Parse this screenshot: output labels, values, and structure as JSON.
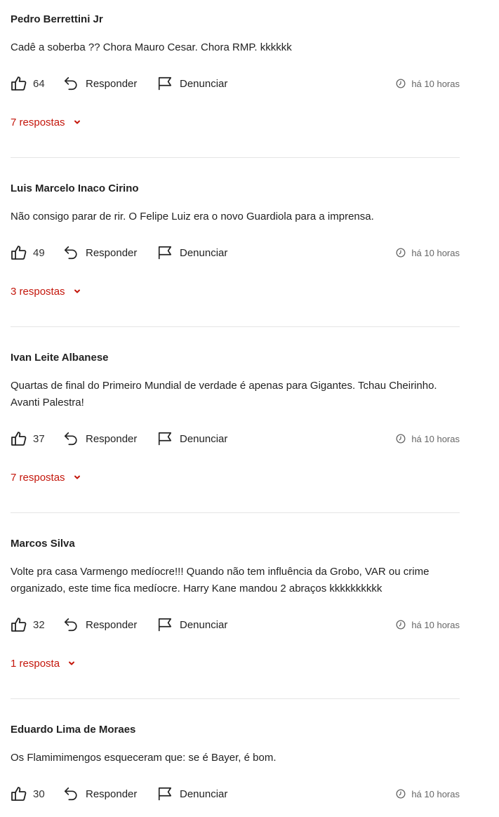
{
  "labels": {
    "reply": "Responder",
    "report": "Denunciar"
  },
  "colors": {
    "accent": "#c4170c",
    "text": "#222222",
    "muted": "#666666",
    "divider": "#e5e5e5"
  },
  "icons": {
    "like": "thumbs-up-icon",
    "reply": "reply-arrow-icon",
    "report": "flag-icon",
    "time": "clock-icon",
    "expand": "chevron-down-icon"
  },
  "comments": [
    {
      "author": "Pedro Berrettini Jr",
      "text": "Cadê a soberba ?? Chora Mauro Cesar. Chora RMP. kkkkkk",
      "likes": "64",
      "time": "há 10 horas",
      "replies": "7 respostas"
    },
    {
      "author": "Luis Marcelo Inaco Cirino",
      "text": "Não consigo parar de rir. O Felipe Luiz era o novo Guardiola para a imprensa.",
      "likes": "49",
      "time": "há 10 horas",
      "replies": "3 respostas"
    },
    {
      "author": "Ivan Leite Albanese",
      "text": "Quartas de final do Primeiro Mundial de verdade é apenas para Gigantes. Tchau Cheirinho. Avanti Palestra!",
      "likes": "37",
      "time": "há 10 horas",
      "replies": "7 respostas"
    },
    {
      "author": "Marcos Silva",
      "text": "Volte pra casa Varmengo medíocre!!! Quando não tem influência da Grobo, VAR ou crime organizado, este time fica medíocre.  Harry Kane mandou 2 abraços kkkkkkkkkk",
      "likes": "32",
      "time": "há 10 horas",
      "replies": "1 resposta"
    },
    {
      "author": "Eduardo Lima de Moraes",
      "text": "Os Flamimimengos esqueceram que: se é Bayer, é bom.",
      "likes": "30",
      "time": "há 10 horas",
      "replies": ""
    }
  ]
}
